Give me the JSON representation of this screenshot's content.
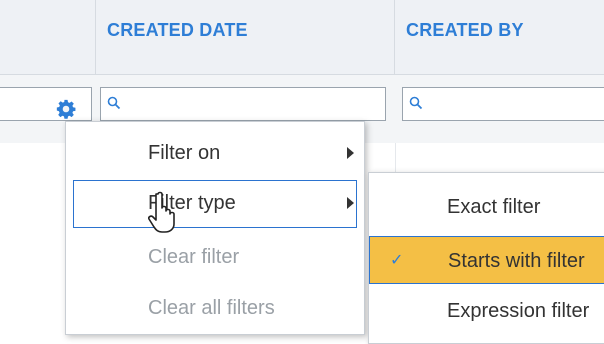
{
  "header": {
    "columns": [
      "",
      "CREATED DATE",
      "CREATED BY"
    ]
  },
  "filter_row": {
    "inputs": [
      "",
      "",
      ""
    ]
  },
  "context_menu": {
    "items": [
      {
        "label": "Filter on",
        "has_submenu": true,
        "enabled": true
      },
      {
        "label": "Filter type",
        "has_submenu": true,
        "enabled": true,
        "focused": true
      },
      {
        "label": "Clear filter",
        "has_submenu": false,
        "enabled": false
      },
      {
        "label": "Clear all filters",
        "has_submenu": false,
        "enabled": false
      }
    ]
  },
  "submenu": {
    "items": [
      {
        "label": "Exact filter",
        "selected": false
      },
      {
        "label": "Starts with filter",
        "selected": true
      },
      {
        "label": "Expression filter",
        "selected": false
      }
    ],
    "check_glyph": "✓"
  },
  "colors": {
    "accent": "#2e7ed6",
    "highlight": "#f4bf45"
  }
}
